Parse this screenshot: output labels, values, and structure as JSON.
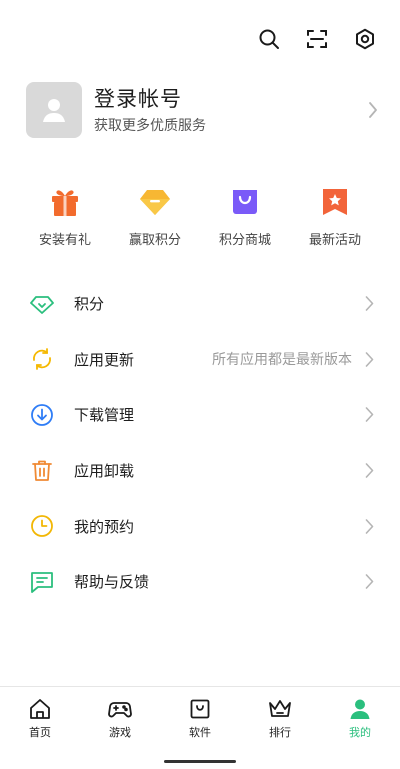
{
  "profile": {
    "title": "登录帐号",
    "subtitle": "获取更多优质服务"
  },
  "quick_actions": [
    {
      "label": "安装有礼",
      "icon": "gift-icon"
    },
    {
      "label": "赢取积分",
      "icon": "diamond-icon"
    },
    {
      "label": "积分商城",
      "icon": "shopping-bag-icon"
    },
    {
      "label": "最新活动",
      "icon": "star-ribbon-icon"
    }
  ],
  "menu": [
    {
      "label": "积分",
      "value": "",
      "icon": "diamond-outline-icon"
    },
    {
      "label": "应用更新",
      "value": "所有应用都是最新版本",
      "icon": "refresh-icon"
    },
    {
      "label": "下载管理",
      "value": "",
      "icon": "download-icon"
    },
    {
      "label": "应用卸载",
      "value": "",
      "icon": "trash-icon"
    },
    {
      "label": "我的预约",
      "value": "",
      "icon": "clock-icon"
    },
    {
      "label": "帮助与反馈",
      "value": "",
      "icon": "feedback-icon"
    }
  ],
  "bottom_nav": [
    {
      "label": "首页",
      "icon": "home-icon"
    },
    {
      "label": "游戏",
      "icon": "gamepad-icon"
    },
    {
      "label": "软件",
      "icon": "app-box-icon"
    },
    {
      "label": "排行",
      "icon": "crown-icon"
    },
    {
      "label": "我的",
      "icon": "person-icon",
      "active": true
    }
  ],
  "colors": {
    "accent_green": "#2bbf7e",
    "gift_orange": "#f26b2d",
    "diamond_yellow": "#f7b733",
    "bag_purple": "#7a5af8",
    "ribbon_orange": "#f2643a",
    "refresh_yellow": "#f5b800",
    "download_blue": "#2f7df6",
    "trash_orange": "#f08a34",
    "clock_yellow": "#f2b705",
    "feedback_green": "#2bbf7e"
  }
}
